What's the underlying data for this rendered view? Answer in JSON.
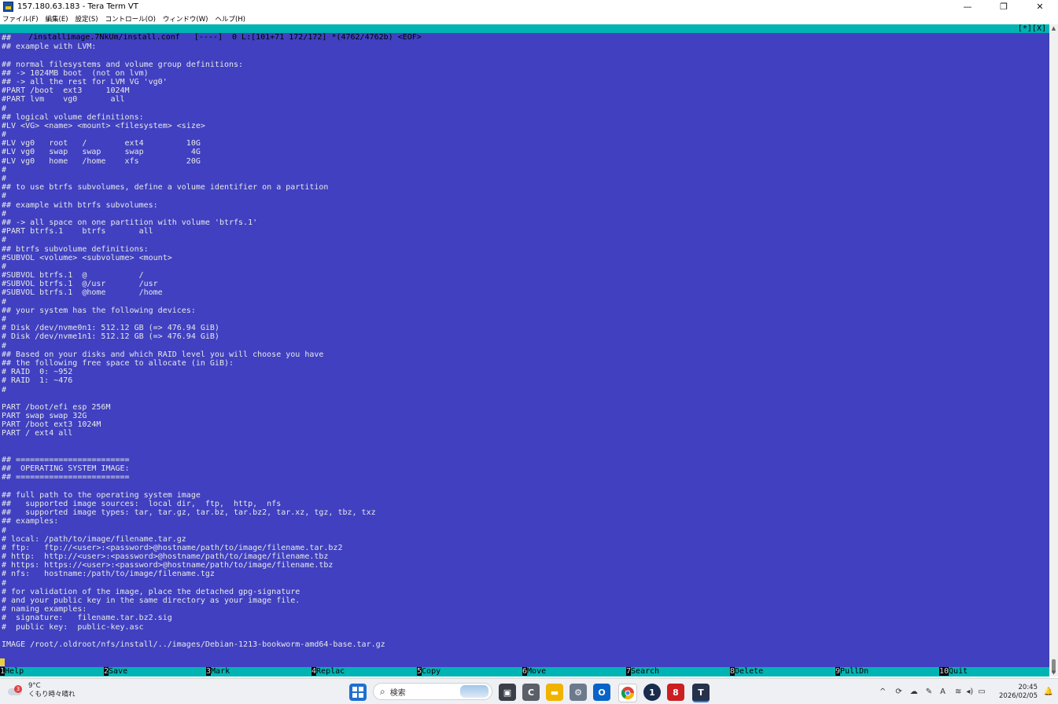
{
  "window": {
    "title": "157.180.63.183 - Tera Term VT",
    "buttons": {
      "minimize": "—",
      "maximize": "❐",
      "close": "✕"
    }
  },
  "menu": [
    "ファイル(F)",
    "編集(E)",
    "設定(S)",
    "コントロール(O)",
    "ウィンドウ(W)",
    "ヘルプ(H)"
  ],
  "editor": {
    "status_left": "/installimage.7NkUm/install.conf   [----]  0 L:[101+71 172/172] *(4762/4762b) <EOF>",
    "status_right": "[*][X]",
    "lines": [
      "##",
      "## example with LVM:",
      "",
      "## normal filesystems and volume group definitions:",
      "## -> 1024MB boot  (not on lvm)",
      "## -> all the rest for LVM VG 'vg0'",
      "#PART /boot  ext3     1024M",
      "#PART lvm    vg0       all",
      "#",
      "## logical volume definitions:",
      "#LV <VG> <name> <mount> <filesystem> <size>",
      "#",
      "#LV vg0   root   /        ext4         10G",
      "#LV vg0   swap   swap     swap          4G",
      "#LV vg0   home   /home    xfs          20G",
      "#",
      "#",
      "## to use btrfs subvolumes, define a volume identifier on a partition",
      "#",
      "## example with btrfs subvolumes:",
      "#",
      "## -> all space on one partition with volume 'btrfs.1'",
      "#PART btrfs.1    btrfs       all",
      "#",
      "## btrfs subvolume definitions:",
      "#SUBVOL <volume> <subvolume> <mount>",
      "#",
      "#SUBVOL btrfs.1  @           /",
      "#SUBVOL btrfs.1  @/usr       /usr",
      "#SUBVOL btrfs.1  @home       /home",
      "#",
      "## your system has the following devices:",
      "#",
      "# Disk /dev/nvme0n1: 512.12 GB (=> 476.94 GiB)",
      "# Disk /dev/nvme1n1: 512.12 GB (=> 476.94 GiB)",
      "#",
      "## Based on your disks and which RAID level you will choose you have",
      "## the following free space to allocate (in GiB):",
      "# RAID  0: ~952",
      "# RAID  1: ~476",
      "#",
      "",
      "PART /boot/efi esp 256M",
      "PART swap swap 32G",
      "PART /boot ext3 1024M",
      "PART / ext4 all",
      "",
      "",
      "## ========================",
      "##  OPERATING SYSTEM IMAGE:",
      "## ========================",
      "",
      "## full path to the operating system image",
      "##   supported image sources:  local dir,  ftp,  http,  nfs",
      "##   supported image types: tar, tar.gz, tar.bz, tar.bz2, tar.xz, tgz, tbz, txz",
      "## examples:",
      "#",
      "# local: /path/to/image/filename.tar.gz",
      "# ftp:   ftp://<user>:<password>@hostname/path/to/image/filename.tar.bz2",
      "# http:  http://<user>:<password>@hostname/path/to/image/filename.tbz",
      "# https: https://<user>:<password>@hostname/path/to/image/filename.tbz",
      "# nfs:   hostname:/path/to/image/filename.tgz",
      "#",
      "# for validation of the image, place the detached gpg-signature",
      "# and your public key in the same directory as your image file.",
      "# naming examples:",
      "#  signature:   filename.tar.bz2.sig",
      "#  public key:  public-key.asc",
      "",
      "IMAGE /root/.oldroot/nfs/install/../images/Debian-1213-bookworm-amd64-base.tar.gz",
      "",
      ""
    ],
    "fkeys": [
      {
        "num": "1",
        "label": "Help"
      },
      {
        "num": "2",
        "label": "Save"
      },
      {
        "num": "3",
        "label": "Mark"
      },
      {
        "num": "4",
        "label": "Replac"
      },
      {
        "num": "5",
        "label": "Copy"
      },
      {
        "num": "6",
        "label": "Move"
      },
      {
        "num": "7",
        "label": "Search"
      },
      {
        "num": "8",
        "label": "Delete"
      },
      {
        "num": "9",
        "label": "PullDn"
      },
      {
        "num": "10",
        "label": "Quit"
      }
    ]
  },
  "taskbar": {
    "weather_temp": "9°C",
    "weather_desc": "くもり時々晴れ",
    "weather_badge": "3",
    "search_placeholder": "検索",
    "apps": [
      "windows-start-icon",
      "task-view-icon",
      "terminal-c-icon",
      "file-explorer-icon",
      "settings-icon",
      "outlook-icon",
      "chrome-icon",
      "1password-icon",
      "app-8-icon",
      "tera-term-icon"
    ],
    "tray": {
      "chevron": "^",
      "ime": "A"
    },
    "time": "20:45",
    "date": "2026/02/05"
  }
}
